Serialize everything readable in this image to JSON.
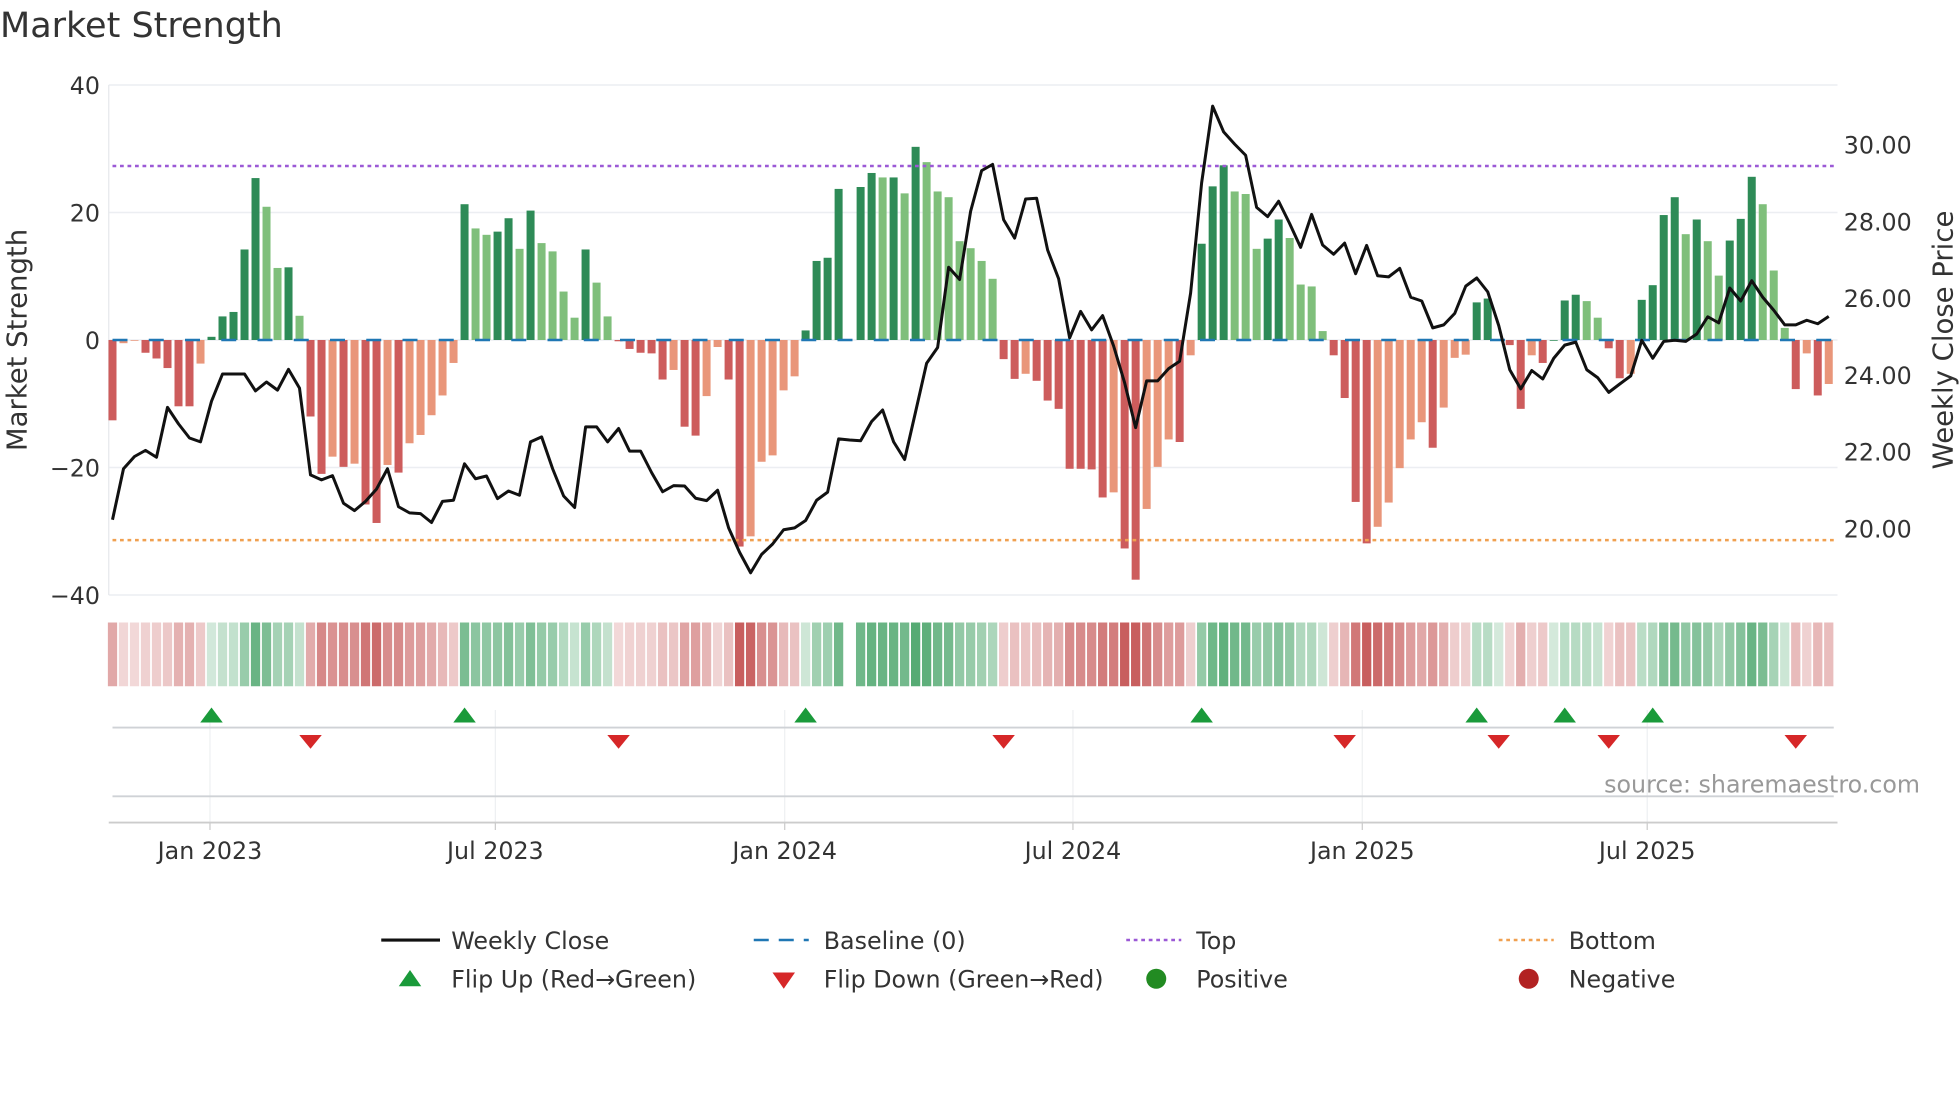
{
  "title": "Market Strength",
  "watermark": "source: sharemaestro.com",
  "legend": {
    "weekly_close": "Weekly Close",
    "baseline": "Baseline (0)",
    "top": "Top",
    "bottom": "Bottom",
    "flip_up": "Flip Up (Red→Green)",
    "flip_down": "Flip Down (Green→Red)",
    "positive": "Positive",
    "negative": "Negative"
  },
  "colors": {
    "pos_strong": "#2e8b57",
    "pos_weak": "#7fbf7b",
    "neg_strong": "#cd5c5c",
    "neg_weak": "#e9967a",
    "close": "#111111",
    "baseline": "#1f77b4",
    "top": "#9b59d6",
    "bottom": "#f0a050",
    "flip_up": "#1a9a3a",
    "flip_down": "#d62728",
    "positive_dot": "#228b22",
    "negative_dot": "#b22222"
  },
  "chart_data": {
    "type": "bar+line",
    "title": "Market Strength",
    "ylabel": "Market Strength",
    "y2label": "Weekly Close Price",
    "ylim": [
      -40,
      40
    ],
    "y2lim": [
      18.27,
      31.56
    ],
    "yticks": [
      40,
      20,
      0,
      -20,
      -40
    ],
    "ytick_labels": [
      "40",
      "20",
      "0",
      "−20",
      "−40"
    ],
    "y2ticks": [
      30,
      28,
      26,
      24,
      22,
      20
    ],
    "y2tick_labels": [
      "30.00",
      "28.00",
      "26.00",
      "24.00",
      "22.00",
      "20.00"
    ],
    "xticks": [
      8.86,
      34.8,
      61.1,
      87.3,
      113.6,
      139.5
    ],
    "xtick_labels": [
      "Jan 2023",
      "Jul 2023",
      "Jan 2024",
      "Jul 2024",
      "Jan 2025",
      "Jul 2025"
    ],
    "frequency": "weekly",
    "top_level": 27.3,
    "bottom_level": -31.4,
    "baseline": 0,
    "strength": [
      -12.6,
      -0.5,
      -0.1,
      -2,
      -2.9,
      -4.4,
      -10.4,
      -10.4,
      -3.7,
      0.5,
      3.7,
      4.4,
      14.2,
      25.4,
      20.9,
      11.3,
      11.4,
      3.8,
      -12,
      -21,
      -18.3,
      -19.9,
      -19.4,
      -25.8,
      -28.7,
      -19.6,
      -20.8,
      -16.2,
      -14.9,
      -11.8,
      -8.7,
      -3.6,
      21.3,
      17.5,
      16.5,
      17,
      19.1,
      14.3,
      20.3,
      15.2,
      13.9,
      7.6,
      3.5,
      14.2,
      9,
      3.7,
      -0.2,
      -1.4,
      -2,
      -2.1,
      -6.2,
      -4.7,
      -13.6,
      -15,
      -8.8,
      -1.1,
      -6.2,
      -32.4,
      -30.8,
      -19.1,
      -18.1,
      -7.9,
      -5.7,
      1.5,
      12.4,
      12.9,
      23.7,
      null,
      24,
      26.2,
      25.5,
      25.5,
      23,
      30.3,
      27.9,
      23.3,
      22.4,
      15.5,
      14.4,
      12.4,
      9.6,
      -3,
      -6.1,
      -5.3,
      -6.4,
      -9.5,
      -10.8,
      -20.2,
      -20.2,
      -20.3,
      -24.7,
      -23.9,
      -32.7,
      -37.6,
      -26.5,
      -19.9,
      -15.6,
      -16,
      -2.4,
      15.1,
      24.1,
      27.4,
      23.3,
      22.9,
      14.3,
      15.9,
      18.9,
      16,
      8.7,
      8.4,
      1.4,
      -2.4,
      -9.1,
      -25.4,
      -31.9,
      -29.3,
      -25.5,
      -20.1,
      -15.6,
      -12.9,
      -16.9,
      -10.6,
      -2.8,
      -2.3,
      5.9,
      6.5,
      0,
      -0.8,
      -10.8,
      -2.4,
      -3.6,
      0,
      6.2,
      7.1,
      6.1,
      3.5,
      -1.3,
      -6,
      -5.3,
      6.3,
      8.6,
      19.6,
      22.4,
      16.6,
      18.9,
      15.5,
      10.1,
      15.6,
      19,
      25.6,
      21.3,
      10.9,
      1.9,
      -7.7,
      -2.1,
      -8.7,
      -6.9
    ],
    "close": [
      20.23,
      21.56,
      21.88,
      22.04,
      21.86,
      23.16,
      22.73,
      22.36,
      22.26,
      23.32,
      24.03,
      24.03,
      24.03,
      23.59,
      23.82,
      23.61,
      24.15,
      23.66,
      21.4,
      21.27,
      21.38,
      20.66,
      20.47,
      20.71,
      21.03,
      21.56,
      20.57,
      20.41,
      20.39,
      20.16,
      20.71,
      20.74,
      21.69,
      21.3,
      21.37,
      20.78,
      20.98,
      20.87,
      22.26,
      22.39,
      21.56,
      20.85,
      20.55,
      22.65,
      22.65,
      22.26,
      22.61,
      22.02,
      22.02,
      21.46,
      20.96,
      21.12,
      21.11,
      20.79,
      20.73,
      21,
      20.02,
      19.38,
      18.85,
      19.33,
      19.6,
      19.97,
      20.02,
      20.21,
      20.74,
      20.95,
      22.34,
      22.31,
      22.29,
      22.79,
      23.09,
      22.26,
      21.8,
      23.05,
      24.31,
      24.72,
      26.81,
      26.49,
      28.27,
      29.33,
      29.49,
      28.05,
      27.57,
      28.59,
      28.61,
      27.26,
      26.51,
      24.97,
      25.66,
      25.18,
      25.55,
      24.76,
      23.8,
      22.63,
      23.85,
      23.85,
      24.17,
      24.36,
      26.14,
      29.01,
      31.01,
      30.34,
      30.02,
      29.73,
      28.37,
      28.13,
      28.53,
      27.95,
      27.33,
      28.19,
      27.39,
      27.15,
      27.44,
      26.64,
      27.38,
      26.59,
      26.56,
      26.78,
      26.03,
      25.93,
      25.23,
      25.31,
      25.61,
      26.32,
      26.53,
      26.17,
      25.29,
      24.14,
      23.64,
      24.12,
      23.9,
      24.44,
      24.78,
      24.86,
      24.14,
      23.93,
      23.55,
      23.77,
      23.98,
      24.91,
      24.44,
      24.88,
      24.91,
      24.88,
      25.07,
      25.52,
      25.36,
      26.27,
      25.93,
      26.46,
      26.03,
      25.69,
      25.31,
      25.31,
      25.43,
      25.34,
      25.53
    ],
    "flip_up_weeks": [
      9,
      32,
      63,
      99,
      124,
      132,
      140
    ],
    "flip_down_weeks": [
      18,
      46,
      81,
      112,
      126,
      136,
      153
    ],
    "legend_position": "bottom-center"
  }
}
